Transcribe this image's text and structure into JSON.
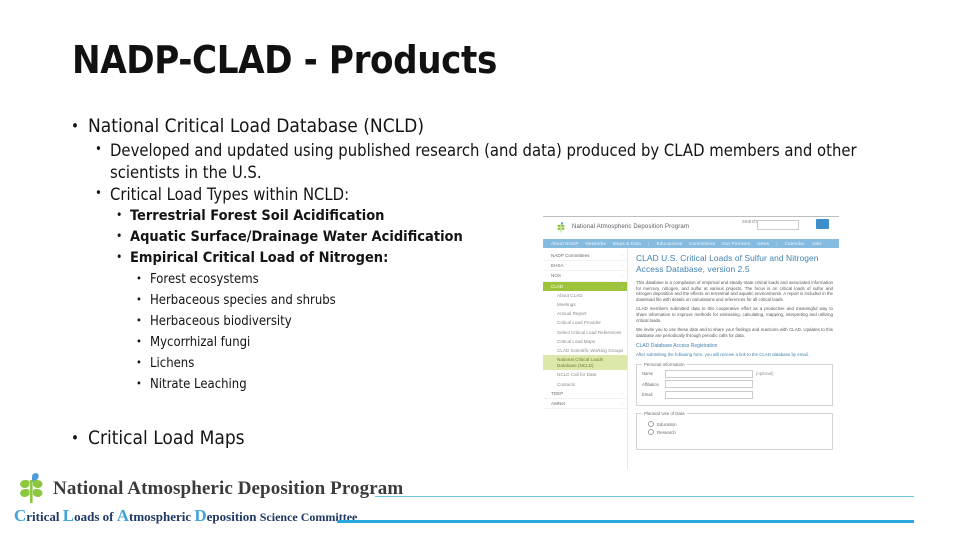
{
  "slide": {
    "title": "NADP-CLAD - Products",
    "bullets": {
      "l1_a": "National Critical Load Database (NCLD)",
      "l2_a": "Developed and updated using published research (and data) produced by CLAD members and other scientists in the U.S.",
      "l2_b": "Critical Load Types within NCLD:",
      "l3": [
        "Terrestrial Forest Soil Acidification",
        "Aquatic Surface/Drainage Water Acidification",
        "Empirical Critical Load of Nitrogen:"
      ],
      "l4": [
        "Forest ecosystems",
        "Herbaceous species and shrubs",
        "Herbaceous biodiversity",
        "Mycorrhizal fungi",
        "Lichens",
        "Nitrate Leaching"
      ],
      "l1_b": "Critical Load Maps"
    }
  },
  "screenshot": {
    "org_name": "National Atmospheric Deposition Program",
    "search_label": "search",
    "nav": [
      "About NADP",
      "Networks",
      "Maps & Data",
      "Educational",
      "Committees",
      "Our Partners",
      "News",
      "Calendar",
      "Jobs"
    ],
    "sidebar": [
      {
        "label": "NADP Committees",
        "type": "top",
        "caret": "›"
      },
      {
        "label": "EHSA",
        "type": "top",
        "caret": "›"
      },
      {
        "label": "NOS",
        "type": "top",
        "caret": "›"
      },
      {
        "label": "CLAD",
        "type": "active",
        "caret": "‹"
      },
      {
        "label": "About CLAD",
        "type": "sub"
      },
      {
        "label": "Meetings",
        "type": "sub"
      },
      {
        "label": "Annual Report",
        "type": "sub"
      },
      {
        "label": "Critical Load Provider",
        "type": "sub"
      },
      {
        "label": "Select Critical Load References",
        "type": "sub"
      },
      {
        "label": "Critical Load Maps",
        "type": "sub"
      },
      {
        "label": "CLAD Scientific Working Groups",
        "type": "sub"
      },
      {
        "label": "National Critical Loads Database (NCLD)",
        "type": "sub2"
      },
      {
        "label": "NCLD Call for Data",
        "type": "sub"
      },
      {
        "label": "Contacts",
        "type": "sub"
      },
      {
        "label": "TDEP",
        "type": "top",
        "caret": "›"
      },
      {
        "label": "AMNet",
        "type": "top",
        "caret": "›"
      }
    ],
    "heading": "CLAD U.S. Critical Loads of Sulfur and Nitrogen Access Database, version 2.5",
    "paragraphs": [
      "This database is a compilation of empirical and steady-state critical loads and associated information for mercury, nitrogen, and sulfur at various projects. The focus is on critical loads of sulfur and nitrogen deposition and the effects on terrestrial and aquatic environments. A report is included in the download file with details on calculations and references for all critical loads.",
      "CLAD members submitted data to this cooperative effort as a productive and meaningful way to share information to improve methods for estimating, calculating, mapping, interpreting and utilizing critical loads.",
      "We invite you to use these data and to share your findings and reactions with CLAD. Updates to this database are periodically through periodic calls for data."
    ],
    "form_heading": "CLAD Database Access Registration",
    "form_lead": "After submitting the following form, you will receive a link to the CLAD database by email.",
    "fieldset_personal": "Personal Information",
    "fields": [
      {
        "label": "Name",
        "note": "(optional)"
      },
      {
        "label": "Affiliation",
        "note": ""
      },
      {
        "label": "Email",
        "note": ""
      }
    ],
    "fieldset_use": "Planned Use of Data",
    "use_options": [
      "Education",
      "Research"
    ]
  },
  "footer": {
    "program": "National Atmospheric Deposition Program",
    "committee": {
      "c": "C",
      "c_rest": "ritical ",
      "l": "L",
      "l_rest": "oads ",
      "of": "of ",
      "a": "A",
      "a_rest": "tmospheric ",
      "d": "D",
      "d_rest": "eposition ",
      "tail": "Science Committee"
    }
  }
}
